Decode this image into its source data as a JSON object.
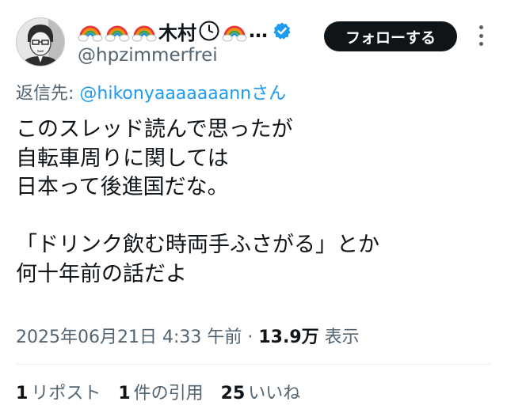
{
  "user": {
    "display_name": "🌈🌈🌈木村🕑🌈…",
    "name_text": "木村",
    "truncation": "…",
    "handle": "@hpzimmerfrei",
    "verified": true
  },
  "follow_button": {
    "label": "フォローする"
  },
  "reply": {
    "prefix": "返信先: ",
    "mention": "@hikonyaaaaaaannさん"
  },
  "tweet": {
    "lines": [
      "このスレッド読んで思ったが",
      "自転車周りに関しては",
      "日本って後進国だな。",
      "",
      "「ドリンク飲む時両手ふさがる」とか",
      "何十年前の話だよ"
    ]
  },
  "meta": {
    "timestamp": "2025年06月21日 4:33 午前",
    "separator": " · ",
    "views_count": "13.9万",
    "views_label": " 表示"
  },
  "stats": {
    "reposts_count": "1",
    "reposts_label": "リポスト",
    "quotes_count": "1",
    "quotes_label": "件の引用",
    "likes_count": "25",
    "likes_label": "いいね"
  },
  "colors": {
    "text": "#0f1419",
    "secondary": "#536471",
    "link": "#1d9bf0",
    "verified": "#1d9bf0",
    "button_bg": "#0f1419"
  }
}
